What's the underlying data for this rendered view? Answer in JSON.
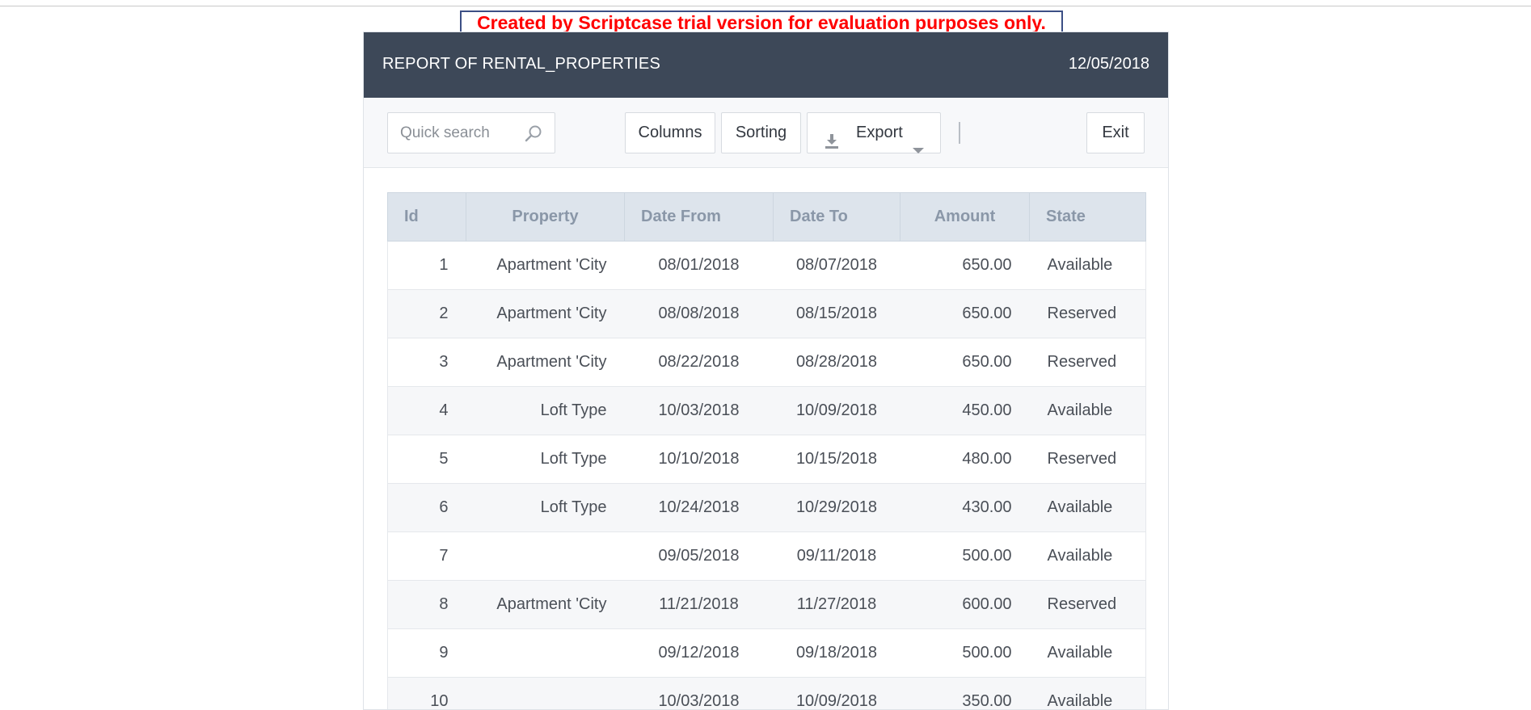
{
  "banner": {
    "text": "Created by Scriptcase trial version for evaluation purposes only."
  },
  "header": {
    "title": "REPORT OF RENTAL_PROPERTIES",
    "date": "12/05/2018"
  },
  "toolbar": {
    "search_placeholder": "Quick search",
    "search_value": "",
    "columns_label": "Columns",
    "sorting_label": "Sorting",
    "export_label": "Export",
    "exit_label": "Exit",
    "icons": {
      "search": "search-icon",
      "export": "download-icon",
      "export_menu": "caret-down-icon"
    }
  },
  "table": {
    "headers": {
      "id": "Id",
      "property": "Property",
      "date_from": "Date From",
      "date_to": "Date To",
      "amount": "Amount",
      "state": "State"
    },
    "rows": [
      {
        "id": "1",
        "property": "Apartment 'City",
        "date_from": "08/01/2018",
        "date_to": "08/07/2018",
        "amount": "650.00",
        "state": "Available"
      },
      {
        "id": "2",
        "property": "Apartment 'City",
        "date_from": "08/08/2018",
        "date_to": "08/15/2018",
        "amount": "650.00",
        "state": "Reserved"
      },
      {
        "id": "3",
        "property": "Apartment 'City",
        "date_from": "08/22/2018",
        "date_to": "08/28/2018",
        "amount": "650.00",
        "state": "Reserved"
      },
      {
        "id": "4",
        "property": "Loft Type",
        "date_from": "10/03/2018",
        "date_to": "10/09/2018",
        "amount": "450.00",
        "state": "Available"
      },
      {
        "id": "5",
        "property": "Loft Type",
        "date_from": "10/10/2018",
        "date_to": "10/15/2018",
        "amount": "480.00",
        "state": "Reserved"
      },
      {
        "id": "6",
        "property": "Loft Type",
        "date_from": "10/24/2018",
        "date_to": "10/29/2018",
        "amount": "430.00",
        "state": "Available"
      },
      {
        "id": "7",
        "property": "",
        "date_from": "09/05/2018",
        "date_to": "09/11/2018",
        "amount": "500.00",
        "state": "Available"
      },
      {
        "id": "8",
        "property": "Apartment 'City",
        "date_from": "11/21/2018",
        "date_to": "11/27/2018",
        "amount": "600.00",
        "state": "Reserved"
      },
      {
        "id": "9",
        "property": "",
        "date_from": "09/12/2018",
        "date_to": "09/18/2018",
        "amount": "500.00",
        "state": "Available"
      },
      {
        "id": "10",
        "property": "",
        "date_from": "10/03/2018",
        "date_to": "10/09/2018",
        "amount": "350.00",
        "state": "Available"
      }
    ]
  },
  "colors": {
    "header_bg": "#3d4858",
    "banner_text": "#ff0000",
    "table_header_bg": "#dde4ec",
    "table_header_text": "#8a97a8",
    "row_alt_bg": "#f6f7f9"
  }
}
